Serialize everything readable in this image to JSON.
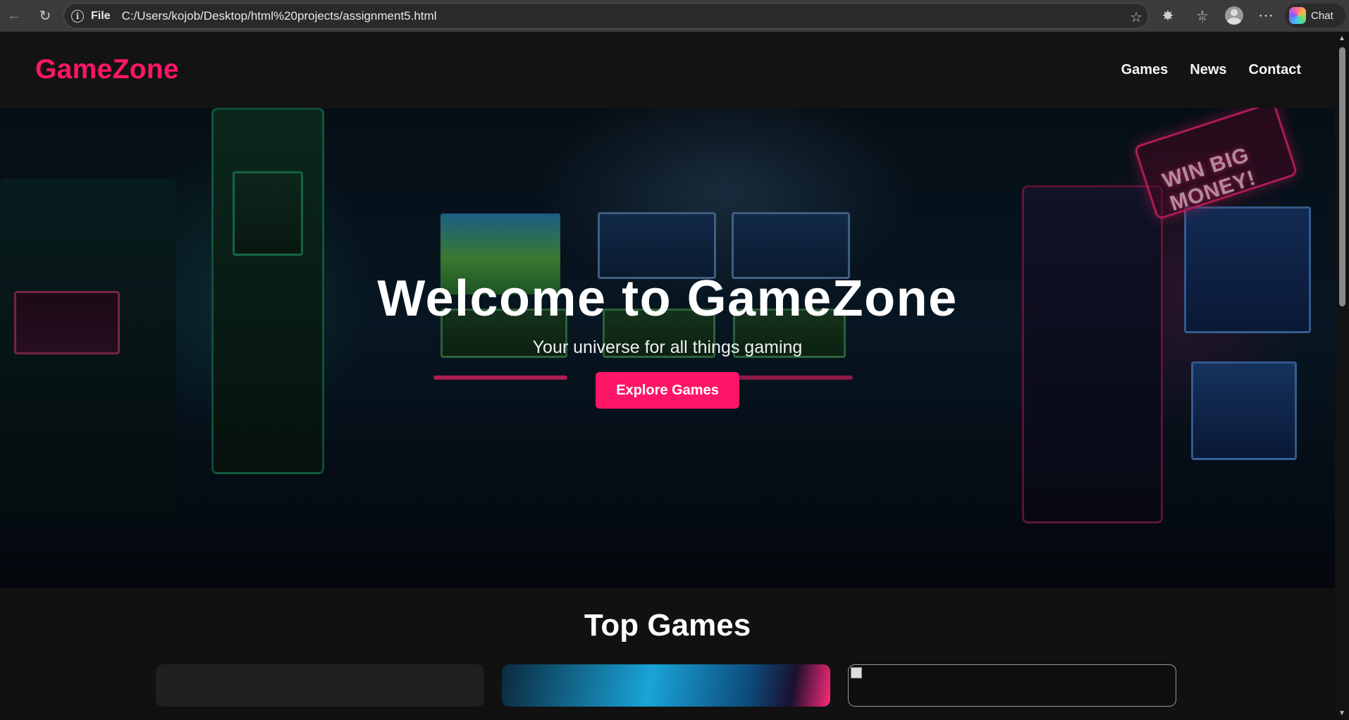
{
  "browser": {
    "scheme_label": "File",
    "url": "C:/Users/kojob/Desktop/html%20projects/assignment5.html",
    "chat_label": "Chat"
  },
  "site": {
    "logo": "GameZone",
    "nav": [
      {
        "label": "Games"
      },
      {
        "label": "News"
      },
      {
        "label": "Contact"
      }
    ]
  },
  "hero": {
    "title": "Welcome to GameZone",
    "subtitle": "Your universe for all things gaming",
    "cta": "Explore Games",
    "sign_text": "WIN BIG MONEY!"
  },
  "top_games": {
    "title": "Top Games"
  },
  "colors": {
    "accent": "#ff1567",
    "header_bg": "#131313",
    "page_bg": "#111111"
  }
}
